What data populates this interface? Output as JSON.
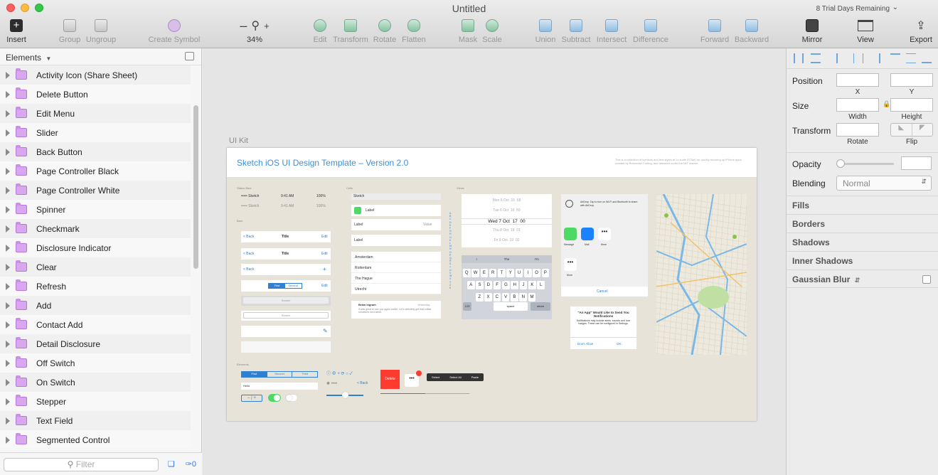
{
  "window": {
    "title": "Untitled",
    "trial": "8 Trial Days Remaining"
  },
  "toolbar": {
    "insert": "Insert",
    "group": "Group",
    "ungroup": "Ungroup",
    "create_symbol": "Create Symbol",
    "zoom_minus": "–",
    "zoom_plus": "+",
    "zoom": "34%",
    "edit": "Edit",
    "transform": "Transform",
    "rotate": "Rotate",
    "flatten": "Flatten",
    "mask": "Mask",
    "scale": "Scale",
    "union": "Union",
    "subtract": "Subtract",
    "intersect": "Intersect",
    "difference": "Difference",
    "forward": "Forward",
    "backward": "Backward",
    "mirror": "Mirror",
    "view": "View",
    "export": "Export"
  },
  "sidebar": {
    "header": "Elements",
    "filter_placeholder": "Filter",
    "count": "0",
    "items": [
      "Activity Icon (Share Sheet)",
      "Delete Button",
      "Edit Menu",
      "Slider",
      "Back Button",
      "Page Controller Black",
      "Page Controller White",
      "Spinner",
      "Checkmark",
      "Disclosure Indicator",
      "Clear",
      "Refresh",
      "Add",
      "Contact Add",
      "Detail Disclosure",
      "Off Switch",
      "On Switch",
      "Stepper",
      "Text Field",
      "Segmented Control"
    ]
  },
  "canvas": {
    "artboard_label": "UI Kit",
    "artboard_title": "Sketch iOS UI Design Template – Version 2.0",
    "artboard_desc": "This is a collection of symbols and text styles at 1x scale (375pt) for quickly mocking up iPhone apps, created by Bohemian Coding, and released under the MIT license.",
    "sections": {
      "status_bars": "Status Bars",
      "bars": "Bars",
      "cells": "Cells",
      "views": "Views",
      "elements": "Elements"
    },
    "status": {
      "carrier": "••••• Sketch",
      "time": "9:41 AM",
      "battery": "100%"
    },
    "bars": {
      "back": "< Back",
      "title": "Title",
      "edit": "Edit",
      "first": "First",
      "second": "Second",
      "search": "Search"
    },
    "cells": {
      "sketch": "Sketch",
      "label": "Label",
      "value": "Value",
      "cities": [
        "Amsterdam",
        "Rotterdam",
        "The Hague",
        "Utrecht"
      ],
      "sender": "Brian Ingram",
      "date": "Yesterday",
      "message": "It was great to see you again earlier. Let's definitely get that coffee sometime next week."
    },
    "picker": {
      "rows": [
        "Mon 6 Oct  15  58",
        "Tue 6 Oct  16  59",
        "Wed 7 Oct  17  00",
        "Thu 8 Oct  18  01",
        "Fri 9 Oct  19  02"
      ]
    },
    "keyboard": {
      "suggest": [
        "I",
        "The",
        "I'm"
      ],
      "row1": "QWERTYUIOP",
      "row2": "ASDFGHJKL",
      "row3": "ZXCVBNM",
      "num": "123",
      "space": "space",
      "ret": "return"
    },
    "share": {
      "airdrop": "AirDrop. Tap to turn on Wi-Fi and Bluetooth to share with AirDrop.",
      "message": "Message",
      "mail": "Mail",
      "more": "More",
      "cancel": "Cancel"
    },
    "alert": {
      "title": "\"An App\" Would Like to Send You Notifications",
      "body": "Notifications may include alerts, sounds and icon badges. These can be configured in Settings.",
      "dont": "Don't Allow",
      "ok": "OK"
    },
    "elements": {
      "first": "First",
      "second": "Second",
      "third": "Third",
      "hello": "Hello",
      "back": "< Back",
      "delete": "Delete",
      "select": "Select",
      "select_all": "Select All",
      "paste": "Paste"
    }
  },
  "inspector": {
    "position": "Position",
    "x": "X",
    "y": "Y",
    "size": "Size",
    "width": "Width",
    "height": "Height",
    "transform": "Transform",
    "rotate": "Rotate",
    "flip": "Flip",
    "opacity": "Opacity",
    "blending": "Blending",
    "blending_value": "Normal",
    "fills": "Fills",
    "borders": "Borders",
    "shadows": "Shadows",
    "inner_shadows": "Inner Shadows",
    "gaussian_blur": "Gaussian Blur"
  }
}
